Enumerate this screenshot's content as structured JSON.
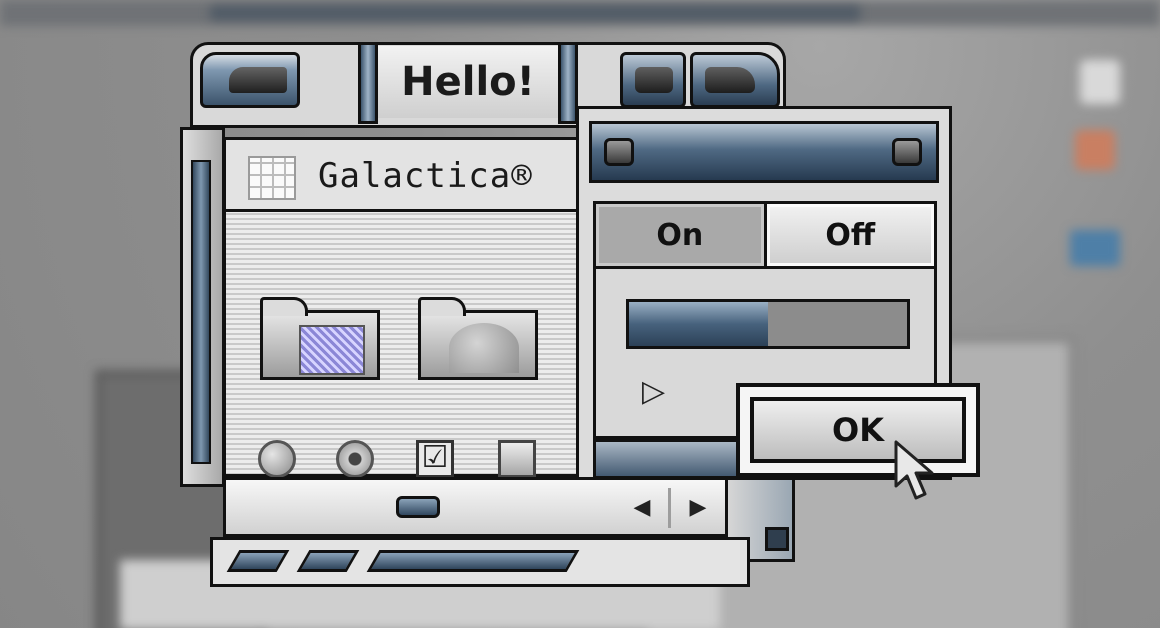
{
  "window": {
    "title": "Hello!"
  },
  "main_panel": {
    "app_name": "Galactica®",
    "icons": [
      {
        "name": "folder-with-document-icon"
      },
      {
        "name": "folder-with-image-icon"
      }
    ],
    "controls": [
      {
        "type": "radio",
        "checked": false
      },
      {
        "type": "radio",
        "checked": true
      },
      {
        "type": "checkbox",
        "checked": true,
        "glyph": "☑"
      },
      {
        "type": "checkbox",
        "checked": false
      }
    ]
  },
  "bottom_bar": {
    "left_arrow": "◀",
    "right_arrow": "▶"
  },
  "dialog": {
    "segments": [
      {
        "label": "On",
        "selected": true
      },
      {
        "label": "Off",
        "selected": false
      }
    ],
    "progress_fraction": 0.5,
    "disclosure_glyph": "▷",
    "ok_label": "OK"
  },
  "colors": {
    "accent_steel_blue": "#4a6480",
    "chrome_light": "#dcdcdc",
    "outline": "#111111"
  }
}
